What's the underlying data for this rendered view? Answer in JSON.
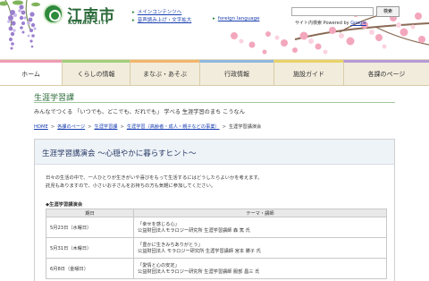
{
  "header": {
    "site_name": "江南市",
    "site_name_roman": "KONAN CITY",
    "links": {
      "main_content": "メインコンテンツへ",
      "voice": "音声読み上げ・文字拡大",
      "foreign": "foreign language"
    },
    "search": {
      "placeholder": "",
      "button_label": "検索",
      "powered_prefix": "サイト内検索",
      "powered_by": "Powered by",
      "powered_name": "Google"
    }
  },
  "nav": {
    "items": [
      {
        "label": "ホーム"
      },
      {
        "label": "くらしの情報"
      },
      {
        "label": "まなぶ・あそぶ"
      },
      {
        "label": "行政情報"
      },
      {
        "label": "施設ガイド"
      },
      {
        "label": "各課のページ"
      }
    ]
  },
  "page": {
    "title": "生涯学習課",
    "tagline": "みんなでつくる 「いつでも、どこでも、だれでも」 学べる 生涯学習のまち こうなん"
  },
  "breadcrumb": {
    "items": [
      "HOME",
      "各課のページ",
      "生涯学習課",
      "生涯学習（高齢者・成人・親子などの事業）"
    ],
    "current": "生涯学習講演会",
    "separator": ">"
  },
  "event": {
    "title": "生涯学習講演会 〜心穏やかに暮らすヒント〜",
    "intro_1": "日々の生活の中で、一人ひとりが生きがいや喜びをもって生活するにはどうしたらよいかを考えます。",
    "intro_2": "託児もありますので、小さいお子さんをお持ちの方も気軽に参加してください。",
    "section_label": "◆生涯学習講演会",
    "table": {
      "headers": [
        "期日",
        "テーマ・講師"
      ],
      "rows": [
        {
          "date": "5月23日（水曜日）",
          "topic": "「幸せを感じる心」",
          "speaker": "公益財団法人モラロジー研究所 生涯学習講師 森 篤 氏"
        },
        {
          "date": "5月31日（木曜日）",
          "topic": "「豊かに生きみちありがとう」",
          "speaker": "公益財団法人 モラロジー研究所 生涯学習講師 宮本 勝子 氏"
        },
        {
          "date": "6月8日（金曜日）",
          "topic": "「愛情と心の安定」",
          "speaker": "公益財団法人モラロジー研究所 生涯学習講師 服部 昌三 氏"
        }
      ]
    }
  },
  "colors": {
    "brand_green": "#2b6a3a",
    "link_blue": "#1a3fb0",
    "nav_bg": "#f2ecdc",
    "title_band": "#eef3f8"
  }
}
